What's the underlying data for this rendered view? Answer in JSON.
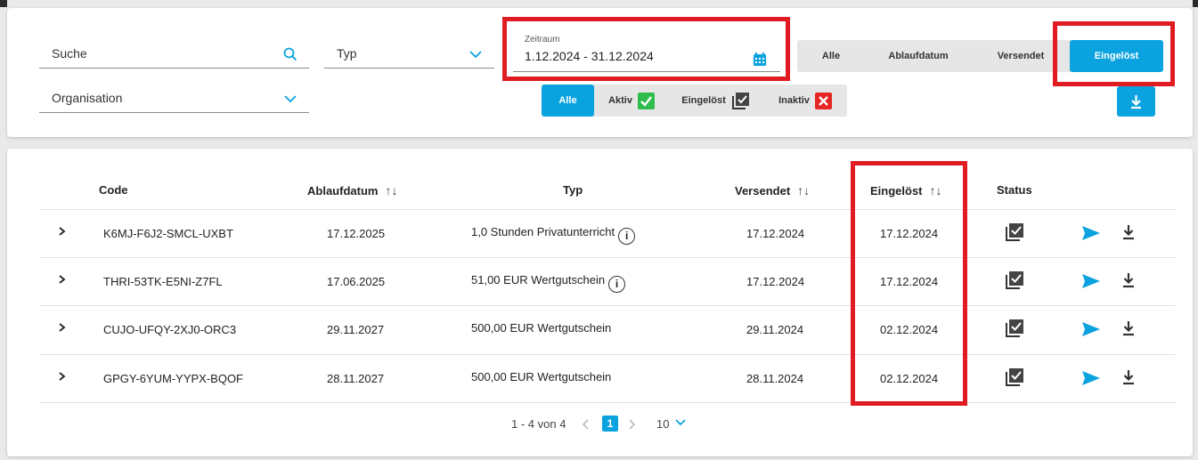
{
  "filters": {
    "search_placeholder": "Suche",
    "typ_placeholder": "Typ",
    "organisation_placeholder": "Organisation",
    "zeitraum_label": "Zeitraum",
    "zeitraum_value": "1.12.2024 - 31.12.2024",
    "date_filter_options": [
      "Alle",
      "Ablaufdatum",
      "Versendet",
      "Eingelöst"
    ],
    "date_filter_selected": "Eingelöst",
    "status_filter_options": [
      "Alle",
      "Aktiv",
      "Eingelöst",
      "Inaktiv"
    ],
    "status_filter_selected": "Alle"
  },
  "table": {
    "headers": [
      "Code",
      "Ablaufdatum",
      "Typ",
      "Versendet",
      "Eingelöst",
      "Status"
    ],
    "rows": [
      {
        "code": "K6MJ-F6J2-SMCL-UXBT",
        "ablauf": "17.12.2025",
        "typ": "1,0 Stunden Privatunterricht",
        "info": true,
        "versendet": "17.12.2024",
        "eingeloest": "17.12.2024"
      },
      {
        "code": "THRI-53TK-E5NI-Z7FL",
        "ablauf": "17.06.2025",
        "typ": "51,00 EUR Wertgutschein",
        "info": true,
        "versendet": "17.12.2024",
        "eingeloest": "17.12.2024"
      },
      {
        "code": "CUJO-UFQY-2XJ0-ORC3",
        "ablauf": "29.11.2027",
        "typ": "500,00 EUR Wertgutschein",
        "info": false,
        "versendet": "29.11.2024",
        "eingeloest": "02.12.2024"
      },
      {
        "code": "GPGY-6YUM-YYPX-BQOF",
        "ablauf": "28.11.2027",
        "typ": "500,00 EUR Wertgutschein",
        "info": false,
        "versendet": "28.11.2024",
        "eingeloest": "02.12.2024"
      }
    ]
  },
  "pagination": {
    "range_text": "1 - 4 von 4",
    "current_page": "1",
    "page_size": "10"
  },
  "colors": {
    "accent": "#0aa3df",
    "highlight": "#e01b22",
    "aktiv": "#2ebd4d",
    "inaktiv": "#e62525"
  }
}
